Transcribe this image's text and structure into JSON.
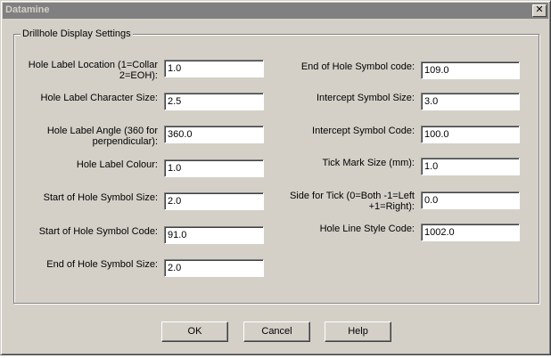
{
  "window": {
    "title": "Datamine",
    "close_glyph": "✕"
  },
  "group": {
    "legend": "Drillhole Display Settings"
  },
  "left_fields": [
    {
      "label": "Hole Label Location (1=Collar 2=EOH):",
      "value": "1.0"
    },
    {
      "label": "Hole Label Character Size:",
      "value": "2.5"
    },
    {
      "label": "Hole Label Angle (360 for perpendicular):",
      "value": "360.0"
    },
    {
      "label": "Hole Label Colour:",
      "value": "1.0"
    },
    {
      "label": "Start of Hole Symbol Size:",
      "value": "2.0"
    },
    {
      "label": "Start of Hole Symbol Code:",
      "value": "91.0"
    },
    {
      "label": "End of Hole Symbol Size:",
      "value": "2.0"
    }
  ],
  "right_fields": [
    {
      "label": "End of Hole Symbol code:",
      "value": "109.0"
    },
    {
      "label": "Intercept Symbol Size:",
      "value": "3.0"
    },
    {
      "label": "Intercept Symbol Code:",
      "value": "100.0"
    },
    {
      "label": "Tick Mark Size (mm):",
      "value": "1.0"
    },
    {
      "label": "Side for Tick (0=Both -1=Left +1=Right):",
      "value": "0.0"
    },
    {
      "label": "Hole Line Style Code:",
      "value": "1002.0"
    }
  ],
  "buttons": {
    "ok": "OK",
    "cancel": "Cancel",
    "help": "Help"
  }
}
